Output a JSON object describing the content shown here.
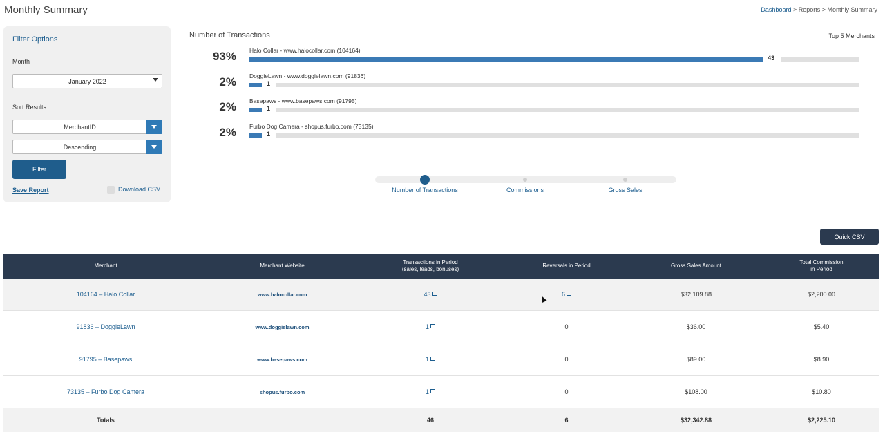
{
  "page": {
    "title": "Monthly Summary",
    "breadcrumb": {
      "link": "Dashboard",
      "rest": " > Reports > Monthly Summary"
    }
  },
  "filter": {
    "title": "Filter Options",
    "month_label": "Month",
    "month_value": "January 2022",
    "sort_label": "Sort Results",
    "sort_field": "MerchantID",
    "sort_order": "Descending",
    "filter_button": "Filter",
    "save_report": "Save Report",
    "download_csv": "Download CSV"
  },
  "chart": {
    "title": "Number of Transactions",
    "top_label": "Top 5 Merchants",
    "bars": [
      {
        "pct": "93%",
        "name": "Halo Collar - www.halocollar.com (104164)",
        "value": 43,
        "value_label": "43"
      },
      {
        "pct": "2%",
        "name": "DoggieLawn - www.doggielawn.com (91836)",
        "value": 1,
        "value_label": "1"
      },
      {
        "pct": "2%",
        "name": "Basepaws - www.basepaws.com (91795)",
        "value": 1,
        "value_label": "1"
      },
      {
        "pct": "2%",
        "name": "Furbo Dog Camera - shopus.furbo.com (73135)",
        "value": 1,
        "value_label": "1"
      }
    ],
    "max_value": 46
  },
  "carousel": {
    "items": [
      "Number of Transactions",
      "Commissions",
      "Gross Sales"
    ],
    "active_index": 0
  },
  "quick_csv": "Quick CSV",
  "table": {
    "headers": [
      "Merchant",
      "Merchant Website",
      "Transactions in Period\n(sales, leads, bonuses)",
      "Reversals in Period",
      "Gross Sales Amount",
      "Total Commission\nin Period"
    ],
    "rows": [
      {
        "merchant": "104164 – Halo Collar",
        "website": "www.halocollar.com",
        "transactions": "43",
        "reversals": "6",
        "reversals_link": true,
        "gross": "$32,109.88",
        "commission": "$2,200.00"
      },
      {
        "merchant": "91836 – DoggieLawn",
        "website": "www.doggielawn.com",
        "transactions": "1",
        "reversals": "0",
        "reversals_link": false,
        "gross": "$36.00",
        "commission": "$5.40"
      },
      {
        "merchant": "91795 – Basepaws",
        "website": "www.basepaws.com",
        "transactions": "1",
        "reversals": "0",
        "reversals_link": false,
        "gross": "$89.00",
        "commission": "$8.90"
      },
      {
        "merchant": "73135 – Furbo Dog Camera",
        "website": "shopus.furbo.com",
        "transactions": "1",
        "reversals": "0",
        "reversals_link": false,
        "gross": "$108.00",
        "commission": "$10.80"
      }
    ],
    "totals": {
      "label": "Totals",
      "transactions": "46",
      "reversals": "6",
      "gross": "$32,342.88",
      "commission": "$2,225.10"
    }
  },
  "colors": {
    "primary": "#1f5d8c",
    "bar": "#3b7ab5",
    "header_bg": "#2b3a4f",
    "link": "#1d5e8f"
  }
}
